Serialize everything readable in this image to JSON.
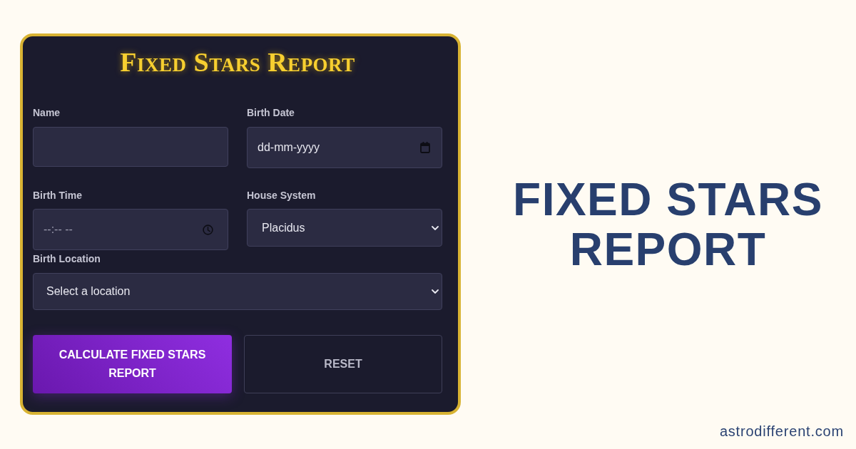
{
  "form": {
    "title": "Fixed Stars Report",
    "rows": [
      [
        {
          "kind": "text",
          "label": "Name"
        },
        {
          "kind": "date",
          "label": "Birth Date",
          "placeholder": "dd-mm-yyyy"
        }
      ],
      [
        {
          "kind": "time",
          "label": "Birth Time",
          "placeholder": "--:-- --"
        },
        {
          "kind": "select",
          "label": "House System",
          "value": "Placidus"
        }
      ],
      [
        {
          "kind": "select",
          "label": "Birth Location",
          "value": "Select a location"
        }
      ]
    ],
    "buttons": [
      {
        "kind": "submit",
        "label": "CALCULATE FIXED STARS REPORT"
      },
      {
        "kind": "reset",
        "label": "RESET"
      }
    ]
  },
  "headline": "FIXED STARS REPORT",
  "footer": "astrodifferent.com"
}
